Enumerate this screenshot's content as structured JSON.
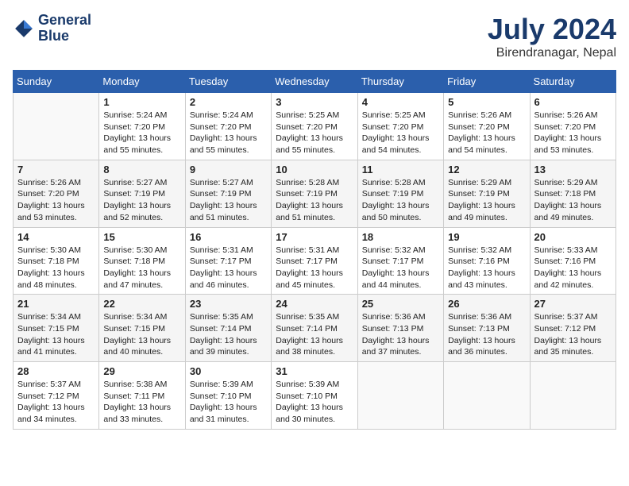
{
  "header": {
    "logo_line1": "General",
    "logo_line2": "Blue",
    "month": "July 2024",
    "location": "Birendranagar, Nepal"
  },
  "weekdays": [
    "Sunday",
    "Monday",
    "Tuesday",
    "Wednesday",
    "Thursday",
    "Friday",
    "Saturday"
  ],
  "weeks": [
    [
      {
        "day": "",
        "info": ""
      },
      {
        "day": "1",
        "info": "Sunrise: 5:24 AM\nSunset: 7:20 PM\nDaylight: 13 hours\nand 55 minutes."
      },
      {
        "day": "2",
        "info": "Sunrise: 5:24 AM\nSunset: 7:20 PM\nDaylight: 13 hours\nand 55 minutes."
      },
      {
        "day": "3",
        "info": "Sunrise: 5:25 AM\nSunset: 7:20 PM\nDaylight: 13 hours\nand 55 minutes."
      },
      {
        "day": "4",
        "info": "Sunrise: 5:25 AM\nSunset: 7:20 PM\nDaylight: 13 hours\nand 54 minutes."
      },
      {
        "day": "5",
        "info": "Sunrise: 5:26 AM\nSunset: 7:20 PM\nDaylight: 13 hours\nand 54 minutes."
      },
      {
        "day": "6",
        "info": "Sunrise: 5:26 AM\nSunset: 7:20 PM\nDaylight: 13 hours\nand 53 minutes."
      }
    ],
    [
      {
        "day": "7",
        "info": "Sunrise: 5:26 AM\nSunset: 7:20 PM\nDaylight: 13 hours\nand 53 minutes."
      },
      {
        "day": "8",
        "info": "Sunrise: 5:27 AM\nSunset: 7:19 PM\nDaylight: 13 hours\nand 52 minutes."
      },
      {
        "day": "9",
        "info": "Sunrise: 5:27 AM\nSunset: 7:19 PM\nDaylight: 13 hours\nand 51 minutes."
      },
      {
        "day": "10",
        "info": "Sunrise: 5:28 AM\nSunset: 7:19 PM\nDaylight: 13 hours\nand 51 minutes."
      },
      {
        "day": "11",
        "info": "Sunrise: 5:28 AM\nSunset: 7:19 PM\nDaylight: 13 hours\nand 50 minutes."
      },
      {
        "day": "12",
        "info": "Sunrise: 5:29 AM\nSunset: 7:19 PM\nDaylight: 13 hours\nand 49 minutes."
      },
      {
        "day": "13",
        "info": "Sunrise: 5:29 AM\nSunset: 7:18 PM\nDaylight: 13 hours\nand 49 minutes."
      }
    ],
    [
      {
        "day": "14",
        "info": "Sunrise: 5:30 AM\nSunset: 7:18 PM\nDaylight: 13 hours\nand 48 minutes."
      },
      {
        "day": "15",
        "info": "Sunrise: 5:30 AM\nSunset: 7:18 PM\nDaylight: 13 hours\nand 47 minutes."
      },
      {
        "day": "16",
        "info": "Sunrise: 5:31 AM\nSunset: 7:17 PM\nDaylight: 13 hours\nand 46 minutes."
      },
      {
        "day": "17",
        "info": "Sunrise: 5:31 AM\nSunset: 7:17 PM\nDaylight: 13 hours\nand 45 minutes."
      },
      {
        "day": "18",
        "info": "Sunrise: 5:32 AM\nSunset: 7:17 PM\nDaylight: 13 hours\nand 44 minutes."
      },
      {
        "day": "19",
        "info": "Sunrise: 5:32 AM\nSunset: 7:16 PM\nDaylight: 13 hours\nand 43 minutes."
      },
      {
        "day": "20",
        "info": "Sunrise: 5:33 AM\nSunset: 7:16 PM\nDaylight: 13 hours\nand 42 minutes."
      }
    ],
    [
      {
        "day": "21",
        "info": "Sunrise: 5:34 AM\nSunset: 7:15 PM\nDaylight: 13 hours\nand 41 minutes."
      },
      {
        "day": "22",
        "info": "Sunrise: 5:34 AM\nSunset: 7:15 PM\nDaylight: 13 hours\nand 40 minutes."
      },
      {
        "day": "23",
        "info": "Sunrise: 5:35 AM\nSunset: 7:14 PM\nDaylight: 13 hours\nand 39 minutes."
      },
      {
        "day": "24",
        "info": "Sunrise: 5:35 AM\nSunset: 7:14 PM\nDaylight: 13 hours\nand 38 minutes."
      },
      {
        "day": "25",
        "info": "Sunrise: 5:36 AM\nSunset: 7:13 PM\nDaylight: 13 hours\nand 37 minutes."
      },
      {
        "day": "26",
        "info": "Sunrise: 5:36 AM\nSunset: 7:13 PM\nDaylight: 13 hours\nand 36 minutes."
      },
      {
        "day": "27",
        "info": "Sunrise: 5:37 AM\nSunset: 7:12 PM\nDaylight: 13 hours\nand 35 minutes."
      }
    ],
    [
      {
        "day": "28",
        "info": "Sunrise: 5:37 AM\nSunset: 7:12 PM\nDaylight: 13 hours\nand 34 minutes."
      },
      {
        "day": "29",
        "info": "Sunrise: 5:38 AM\nSunset: 7:11 PM\nDaylight: 13 hours\nand 33 minutes."
      },
      {
        "day": "30",
        "info": "Sunrise: 5:39 AM\nSunset: 7:10 PM\nDaylight: 13 hours\nand 31 minutes."
      },
      {
        "day": "31",
        "info": "Sunrise: 5:39 AM\nSunset: 7:10 PM\nDaylight: 13 hours\nand 30 minutes."
      },
      {
        "day": "",
        "info": ""
      },
      {
        "day": "",
        "info": ""
      },
      {
        "day": "",
        "info": ""
      }
    ]
  ]
}
